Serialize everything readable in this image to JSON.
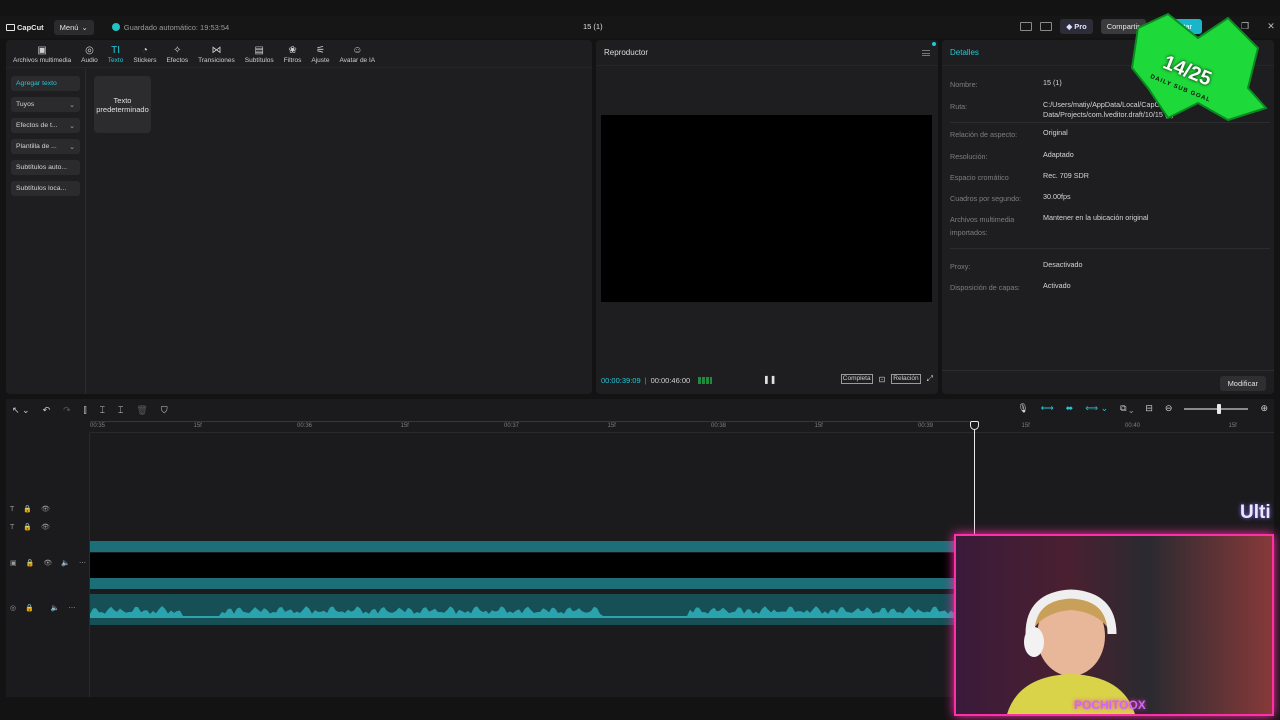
{
  "app": {
    "logo_text": "CapCut",
    "menu_label": "Menú",
    "autosave_text": "Guardado automático: 19:53:54",
    "project_title": "15 (1)",
    "pro_label": "Pro",
    "share_label": "Compartir",
    "export_label": "Exportar"
  },
  "tool_tabs": [
    {
      "label": "Archivos multimedia",
      "icon": "media-icon"
    },
    {
      "label": "Audio",
      "icon": "audio-icon"
    },
    {
      "label": "Texto",
      "icon": "text-icon",
      "active": true
    },
    {
      "label": "Stickers",
      "icon": "sticker-icon"
    },
    {
      "label": "Efectos",
      "icon": "effects-icon"
    },
    {
      "label": "Transiciones",
      "icon": "transitions-icon"
    },
    {
      "label": "Subtítulos",
      "icon": "subtitles-icon"
    },
    {
      "label": "Filtros",
      "icon": "filters-icon"
    },
    {
      "label": "Ajuste",
      "icon": "adjust-icon"
    },
    {
      "label": "Avatar de IA",
      "icon": "ai-avatar-icon"
    }
  ],
  "text_sidebar": [
    {
      "label": "Agregar texto",
      "active": true
    },
    {
      "label": "Tuyos",
      "dropdown": true
    },
    {
      "label": "Efectos de t...",
      "dropdown": true
    },
    {
      "label": "Plantilla de ...",
      "dropdown": true
    },
    {
      "label": "Subtítulos auto..."
    },
    {
      "label": "Subtítulos loca..."
    }
  ],
  "text_card_label": "Texto predeterminado",
  "player": {
    "title": "Reproductor",
    "current_time": "00:00:39:09",
    "total_time": "00:00:46:00",
    "full_label": "Completa",
    "ratio_label": "Relación"
  },
  "details": {
    "title": "Detalles",
    "rows": [
      {
        "label": "Nombre:",
        "value": "15 (1)"
      },
      {
        "label": "Ruta:",
        "value": "C:/Users/matiy/AppData/Local/CapCut/User Data/Projects/com.lveditor.draft/10/15 (1)"
      },
      {
        "label": "Relación de aspecto:",
        "value": "Original"
      },
      {
        "label": "Resolución:",
        "value": "Adaptado"
      },
      {
        "label": "Espacio cromático",
        "value": "Rec. 709 SDR"
      },
      {
        "label": "Cuadros por segundo:",
        "value": "30.00fps"
      },
      {
        "label": "Archivos multimedia importados:",
        "value": "Mantener en la ubicación original"
      },
      {
        "label": "Proxy:",
        "value": "Desactivado"
      },
      {
        "label": "Disposición de capas:",
        "value": "Activado"
      }
    ],
    "modify_label": "Modificar"
  },
  "timeline": {
    "ruler_labels": [
      "00:35",
      "15f",
      "00:36",
      "15f",
      "00:37",
      "15f",
      "00:38",
      "15f",
      "00:39",
      "15f",
      "00:40",
      "15f"
    ]
  },
  "overlay": {
    "streamer_name": "POCHITOOX",
    "right_text": "Ulti",
    "sub_goal_count": "14/25",
    "sub_goal_label": "DAILY SUB GOAL"
  },
  "colors": {
    "accent": "#26c6d6",
    "export": "#18b6c8",
    "clip": "#1c6f78",
    "cam_border": "#ff2fa8"
  }
}
